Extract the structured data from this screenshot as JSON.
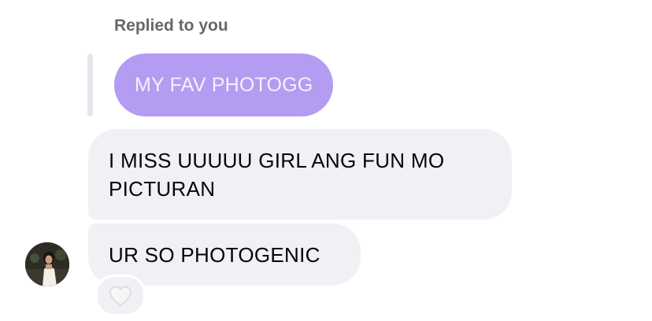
{
  "reply_header": {
    "label": "Replied to you"
  },
  "quoted_message": {
    "text": "MY FAV PHOTOGG",
    "color": "#b49cf2"
  },
  "messages": [
    {
      "text": "I MISS UUUUU GIRL ANG FUN MO PICTURAN"
    },
    {
      "text": "UR SO PHOTOGENIC"
    }
  ],
  "reaction": {
    "icon": "white-heart-icon"
  },
  "colors": {
    "bubble_background": "#eff1f4",
    "secondary_text": "#65676b"
  }
}
